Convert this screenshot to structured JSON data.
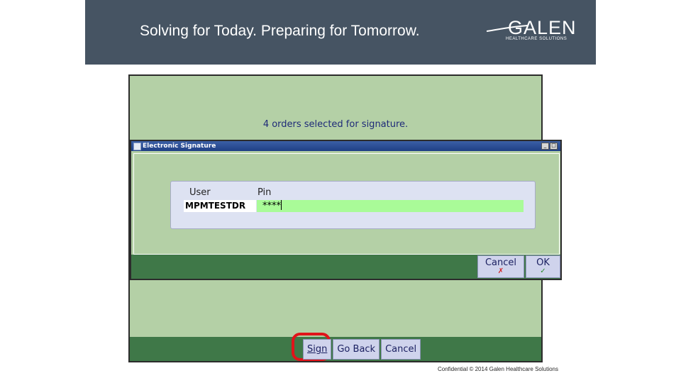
{
  "slide": {
    "tagline": "Solving for Today. Preparing for Tomorrow.",
    "logo": {
      "wordmark": "GALEN",
      "subtext": "HEALTHCARE SOLUTIONS"
    },
    "footer": "Confidential © 2014 Galen Healthcare Solutions"
  },
  "app": {
    "message": "4 orders selected for signature.",
    "buttons": {
      "sign": "Sign",
      "go_back": "Go Back",
      "cancel": "Cancel"
    },
    "highlight_color": "#e0141a"
  },
  "dialog": {
    "title": "Electronic Signature",
    "columns": {
      "user": "User",
      "pin": "Pin"
    },
    "user_value": "MPMTESTDR",
    "pin_value": "****",
    "buttons": {
      "cancel": "Cancel",
      "ok": "OK"
    },
    "icons": {
      "cancel": "x-mark-icon",
      "ok": "check-mark-icon"
    }
  },
  "colors": {
    "header_bg": "#465463",
    "app_bg": "#b4d0a6",
    "bar_green": "#3f7848",
    "pin_field": "#a9fb98",
    "title_bar": "#1f3f85"
  }
}
